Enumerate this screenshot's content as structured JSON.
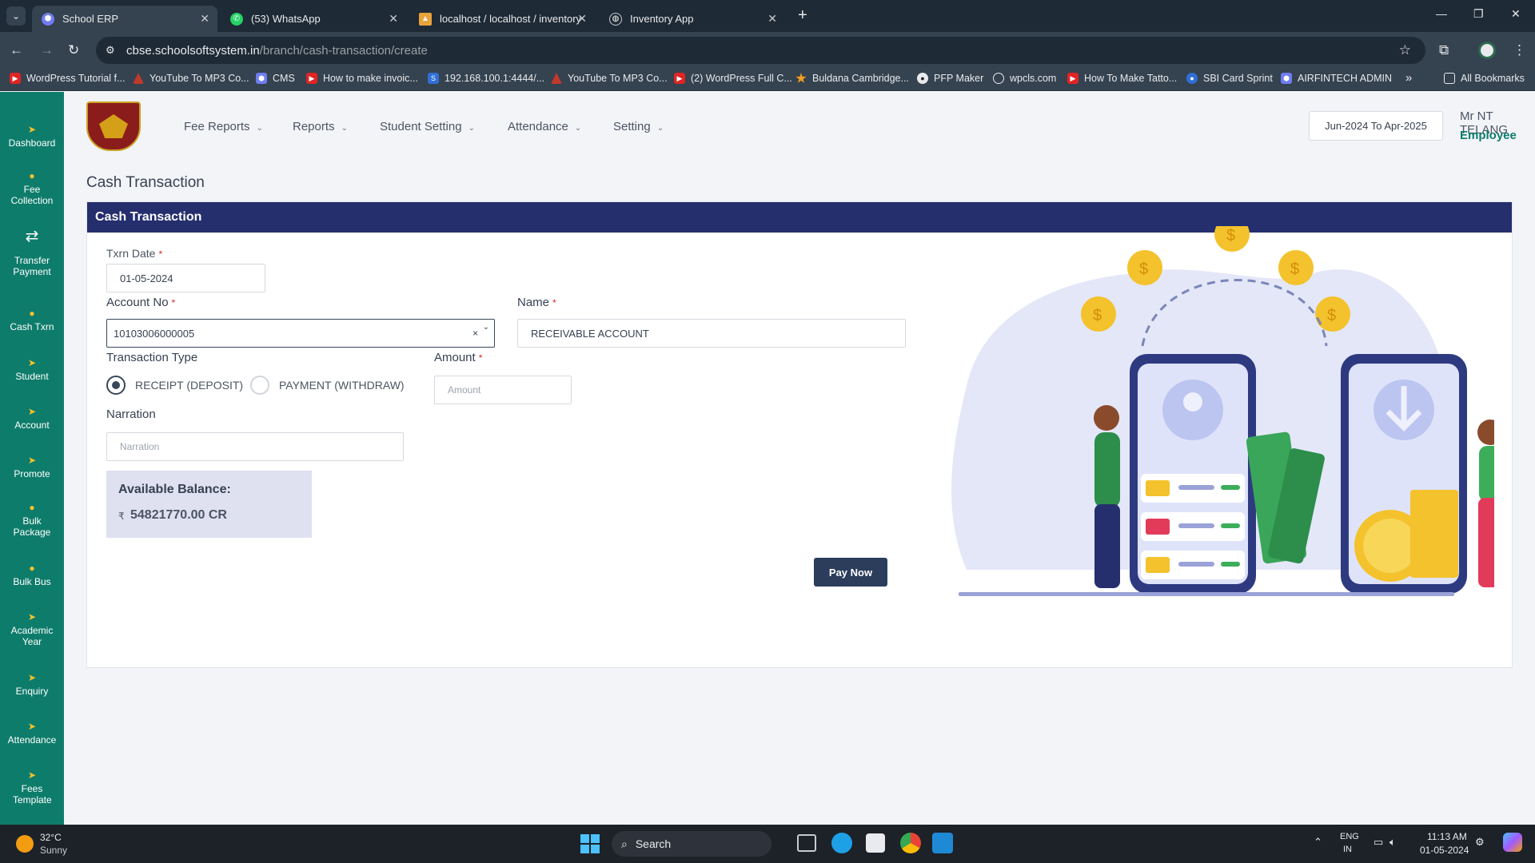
{
  "browser": {
    "tabs": [
      {
        "title": "School ERP",
        "icon": "hexagon-icon",
        "active": true
      },
      {
        "title": "(53) WhatsApp",
        "icon": "whatsapp-icon",
        "active": false
      },
      {
        "title": "localhost / localhost / inventory",
        "icon": "phpmyadmin-icon",
        "active": false
      },
      {
        "title": "Inventory App",
        "icon": "globe-icon",
        "active": false
      }
    ],
    "url_host": "cbse.schoolsoftsystem.in",
    "url_path": "/branch/cash-transaction/create",
    "bookmarks": [
      "WordPress Tutorial f...",
      "YouTube To MP3 Co...",
      "CMS",
      "How to make invoic...",
      "192.168.100.1:4444/...",
      "YouTube To MP3 Co...",
      "(2) WordPress Full C...",
      "Buldana Cambridge...",
      "PFP Maker",
      "wpcls.com",
      "How To Make Tatto...",
      "SBI Card Sprint",
      "AIRFINTECH ADMIN"
    ],
    "all_bookmarks": "All Bookmarks"
  },
  "sidebar": {
    "items": [
      {
        "label": "Dashboard"
      },
      {
        "label": "Fee Collection"
      },
      {
        "label": "Transfer Payment"
      },
      {
        "label": "Cash Txrn"
      },
      {
        "label": "Student"
      },
      {
        "label": "Account"
      },
      {
        "label": "Promote"
      },
      {
        "label": "Bulk Package"
      },
      {
        "label": "Bulk Bus"
      },
      {
        "label": "Academic Year"
      },
      {
        "label": "Enquiry"
      },
      {
        "label": "Attendance"
      },
      {
        "label": "Fees Template"
      }
    ]
  },
  "header": {
    "menu": [
      "Fee Reports",
      "Reports",
      "Student Setting",
      "Attendance",
      "Setting"
    ],
    "session": "Jun-2024 To Apr-2025",
    "user_name": "Mr NT TELANG",
    "user_role": "Employee"
  },
  "page": {
    "title": "Cash Transaction",
    "card_title": "Cash Transaction",
    "txn_date_label": "Txrn Date",
    "txn_date": "01-05-2024",
    "account_label": "Account No",
    "account_value": "10103006000005",
    "name_label": "Name",
    "name_value": "RECEIVABLE ACCOUNT",
    "txn_type_label": "Transaction Type",
    "receipt_label": "RECEIPT (DEPOSIT)",
    "payment_label": "PAYMENT (WITHDRAW)",
    "selected_type": "RECEIPT (DEPOSIT)",
    "amount_label": "Amount",
    "amount_placeholder": "Amount",
    "narration_label": "Narration",
    "narration_placeholder": "Narration",
    "balance_label": "Available Balance:",
    "currency_symbol": "₹",
    "balance_value": "54821770.00 CR",
    "pay_button": "Pay Now"
  },
  "taskbar": {
    "weather_temp": "32°C",
    "weather_desc": "Sunny",
    "search_label": "Search",
    "lang_top": "ENG",
    "lang_bottom": "IN",
    "time": "11:13 AM",
    "date": "01-05-2024"
  },
  "colors": {
    "sidebar": "#0e7c6b",
    "card_header": "#252f6e",
    "pay_button": "#2b3d5b",
    "accent_icon": "#f7c22b"
  }
}
